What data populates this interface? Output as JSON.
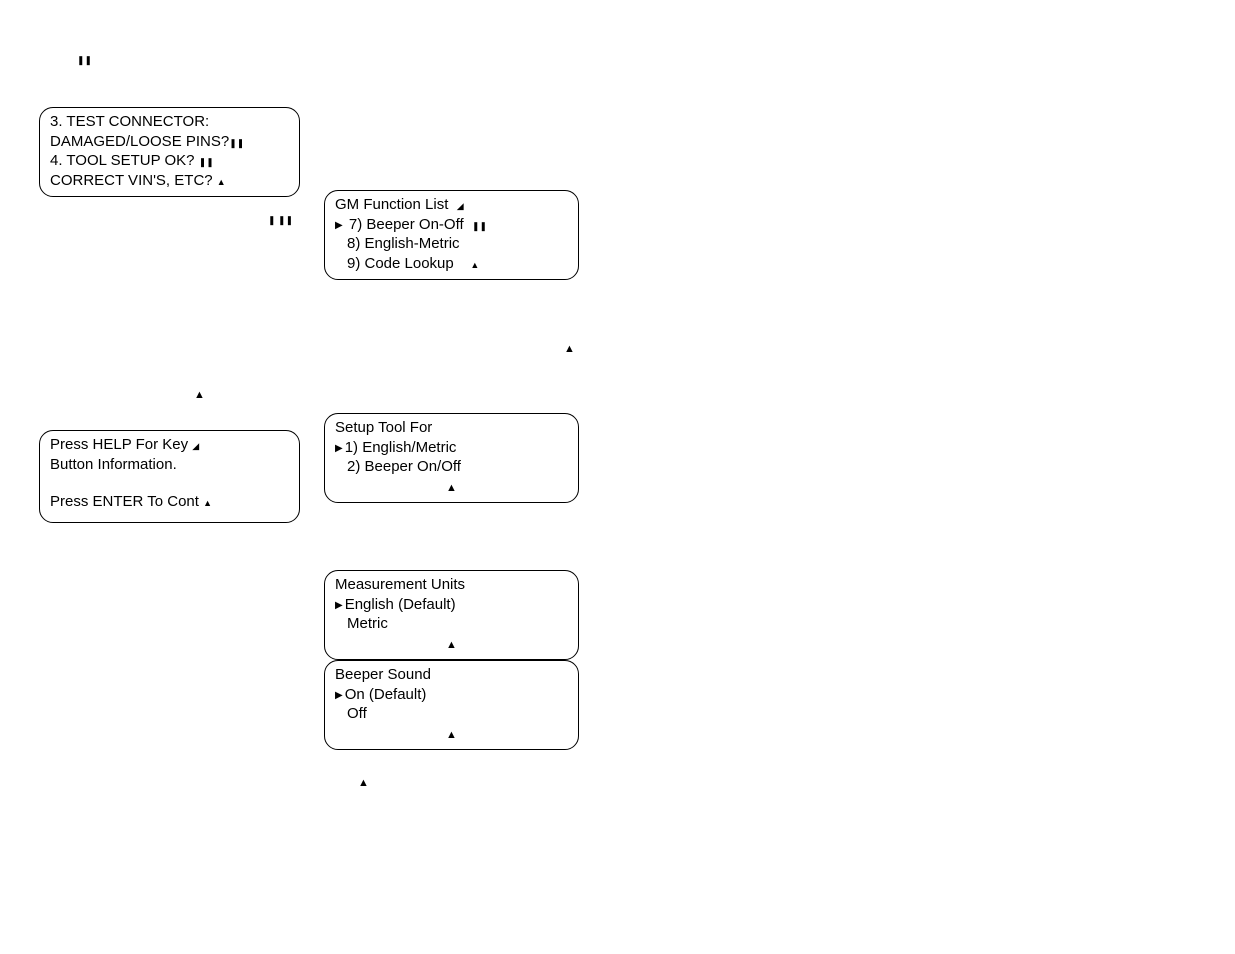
{
  "topGlyph": "❚❚",
  "boxA": {
    "l1": "3. TEST CONNECTOR:",
    "l2": "DAMAGED/LOOSE PINS?",
    "l3": "4. TOOL SETUP OK?",
    "l4": "CORRECT VIN'S, ETC?",
    "g2": "❚❚",
    "g3": "❚❚",
    "g4": "▲"
  },
  "midGlyph": "❚ ❚❚",
  "boxB": {
    "title": "GM Function List",
    "tglyph": "◢",
    "i1": "7) Beeper On-Off",
    "i1g": "❚❚",
    "i2": "8) English-Metric",
    "i3": "9) Code Lookup",
    "i3g": "▲"
  },
  "loneGlyph1": "▲",
  "loneGlyph2": "▲",
  "boxC": {
    "l1": "Press HELP For Key",
    "l1g": "◢",
    "l2": "Button Information.",
    "l3": "Press ENTER To Cont",
    "l3g": "▲"
  },
  "boxD": {
    "title": "Setup Tool For",
    "i1": "1) English/Metric",
    "i2": "2) Beeper On/Off",
    "fg": "▲"
  },
  "boxE": {
    "title": "Measurement Units",
    "i1": "English (Default)",
    "i2": "Metric",
    "fg": "▲"
  },
  "boxF": {
    "title": "Beeper Sound",
    "i1": "On (Default)",
    "i2": "Off",
    "fg": "▲"
  },
  "bottomGlyph": "▲"
}
